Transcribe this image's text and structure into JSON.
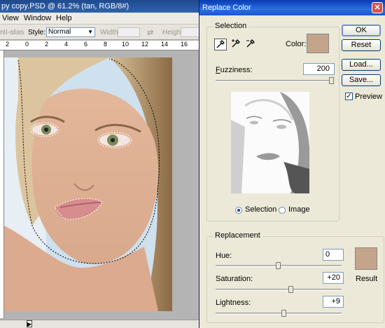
{
  "photoshop": {
    "title": "py copy.PSD @ 61.2% (tan, RGB/8#)",
    "menu": [
      "View",
      "Window",
      "Help"
    ],
    "options": {
      "antialias_label": "nti-alias",
      "style_label": "Style:",
      "style_value": "Normal",
      "width_label": "Width:",
      "height_label": "Height:"
    },
    "ruler_ticks": [
      "2",
      "0",
      "2",
      "4",
      "6",
      "8",
      "10",
      "12",
      "14",
      "16"
    ]
  },
  "dialog": {
    "title": "Replace Color",
    "selection": {
      "group_label": "Selection",
      "color_label": "Color:",
      "color_value": "#c4a58b",
      "fuzziness_label": "Fuzziness:",
      "fuzziness_value": "200",
      "fuzziness_level": 1.0,
      "radio_selection": "Selection",
      "radio_image": "Image",
      "selected_mode": "Selection"
    },
    "buttons": {
      "ok": "OK",
      "reset": "Reset",
      "load": "Load...",
      "save": "Save..."
    },
    "preview_label": "Preview",
    "preview_checked": true,
    "replacement": {
      "group_label": "Replacement",
      "hue_label": "Hue:",
      "hue_value": "0",
      "hue_level": 0.5,
      "saturation_label": "Saturation:",
      "saturation_value": "+20",
      "saturation_level": 0.6,
      "lightness_label": "Lightness:",
      "lightness_value": "+9",
      "lightness_level": 0.545,
      "result_label": "Result",
      "result_color": "#c4a58b"
    }
  }
}
